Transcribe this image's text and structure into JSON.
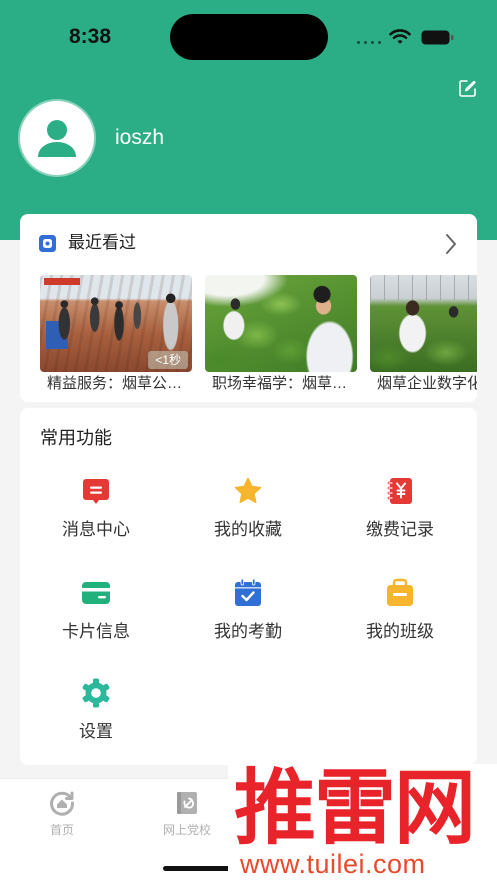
{
  "status_bar": {
    "time": "8:38"
  },
  "profile": {
    "username": "ioszh",
    "avatar_icon": "user-icon",
    "edit_icon": "edit-icon"
  },
  "recent": {
    "title": "最近看过",
    "icon": "recent-icon",
    "more_icon": "chevron-right-icon",
    "items": [
      {
        "caption": "精益服务：烟草公…",
        "duration_badge": "<1秒"
      },
      {
        "caption": "职场幸福学：烟草…"
      },
      {
        "caption": "烟草企业数字化"
      }
    ]
  },
  "functions": {
    "title": "常用功能",
    "items": [
      {
        "label": "消息中心",
        "icon": "message-icon",
        "color": "#E53935"
      },
      {
        "label": "我的收藏",
        "icon": "star-icon",
        "color": "#F6B52C"
      },
      {
        "label": "缴费记录",
        "icon": "payment-record-icon",
        "color": "#E53935"
      },
      {
        "label": "卡片信息",
        "icon": "card-icon",
        "color": "#22B07D"
      },
      {
        "label": "我的考勤",
        "icon": "attendance-calendar-icon",
        "color": "#2F6FD6"
      },
      {
        "label": "我的班级",
        "icon": "class-box-icon",
        "color": "#F6B52C"
      },
      {
        "label": "设置",
        "icon": "gear-icon",
        "color": "#2CB89A"
      }
    ]
  },
  "tab_bar": {
    "items": [
      {
        "label": "首页",
        "icon": "home-icon"
      },
      {
        "label": "网上党校",
        "icon": "party-school-icon"
      }
    ]
  },
  "watermark": {
    "brand": "推雷网",
    "url": "www.tuilei.com"
  },
  "colors": {
    "header_green": "#2BAE85",
    "page_background": "#F4F4F4",
    "tab_inactive": "#B0B0B0",
    "watermark_red": "#E8232A",
    "watermark_url": "#E84A2C",
    "recent_icon_blue": "#2F6FD6"
  }
}
